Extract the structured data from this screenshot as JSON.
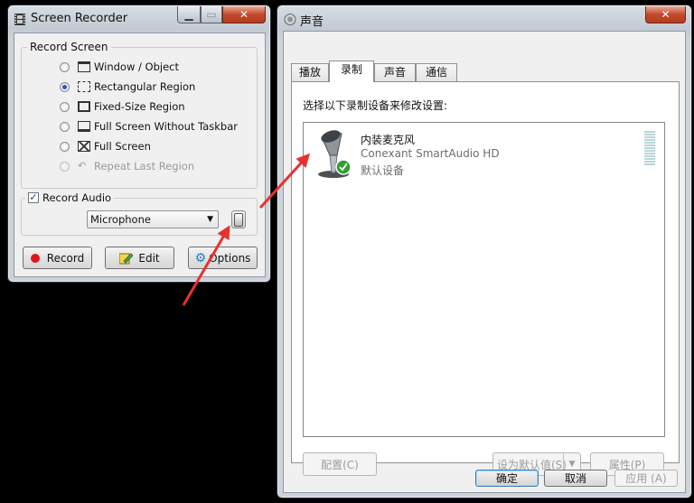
{
  "recorder": {
    "title": "Screen Recorder",
    "record_screen_legend": "Record Screen",
    "modes": [
      {
        "label": "Window / Object",
        "icon": "window-icon",
        "checked": false,
        "disabled": false
      },
      {
        "label": "Rectangular Region",
        "icon": "rectangle-region-icon",
        "checked": true,
        "disabled": false
      },
      {
        "label": "Fixed-Size Region",
        "icon": "fixed-region-icon",
        "checked": false,
        "disabled": false
      },
      {
        "label": "Full Screen Without Taskbar",
        "icon": "screen-no-taskbar-icon",
        "checked": false,
        "disabled": false
      },
      {
        "label": "Full Screen",
        "icon": "full-screen-icon",
        "checked": false,
        "disabled": false
      },
      {
        "label": "Repeat Last Region",
        "icon": "repeat-icon",
        "checked": false,
        "disabled": true
      }
    ],
    "record_audio_label": "Record Audio",
    "record_audio_checked": true,
    "audio_source": "Microphone",
    "buttons": {
      "record": "Record",
      "edit": "Edit",
      "options": "Options"
    }
  },
  "sound": {
    "title": "声音",
    "tabs": [
      {
        "label": "播放",
        "active": false
      },
      {
        "label": "录制",
        "active": true
      },
      {
        "label": "声音",
        "active": false
      },
      {
        "label": "通信",
        "active": false
      }
    ],
    "instruction": "选择以下录制设备来修改设置:",
    "device": {
      "name": "内装麦克风",
      "driver": "Conexant SmartAudio HD",
      "status": "默认设备"
    },
    "buttons": {
      "configure": "配置(C)",
      "set_default": "设为默认值(S)",
      "properties": "属性(P)",
      "ok": "确定",
      "cancel": "取消",
      "apply": "应用 (A)"
    }
  },
  "colors": {
    "annotation_arrow": "#e8312f",
    "record_dot": "#e0141a",
    "check_badge": "#2e9e2e"
  }
}
